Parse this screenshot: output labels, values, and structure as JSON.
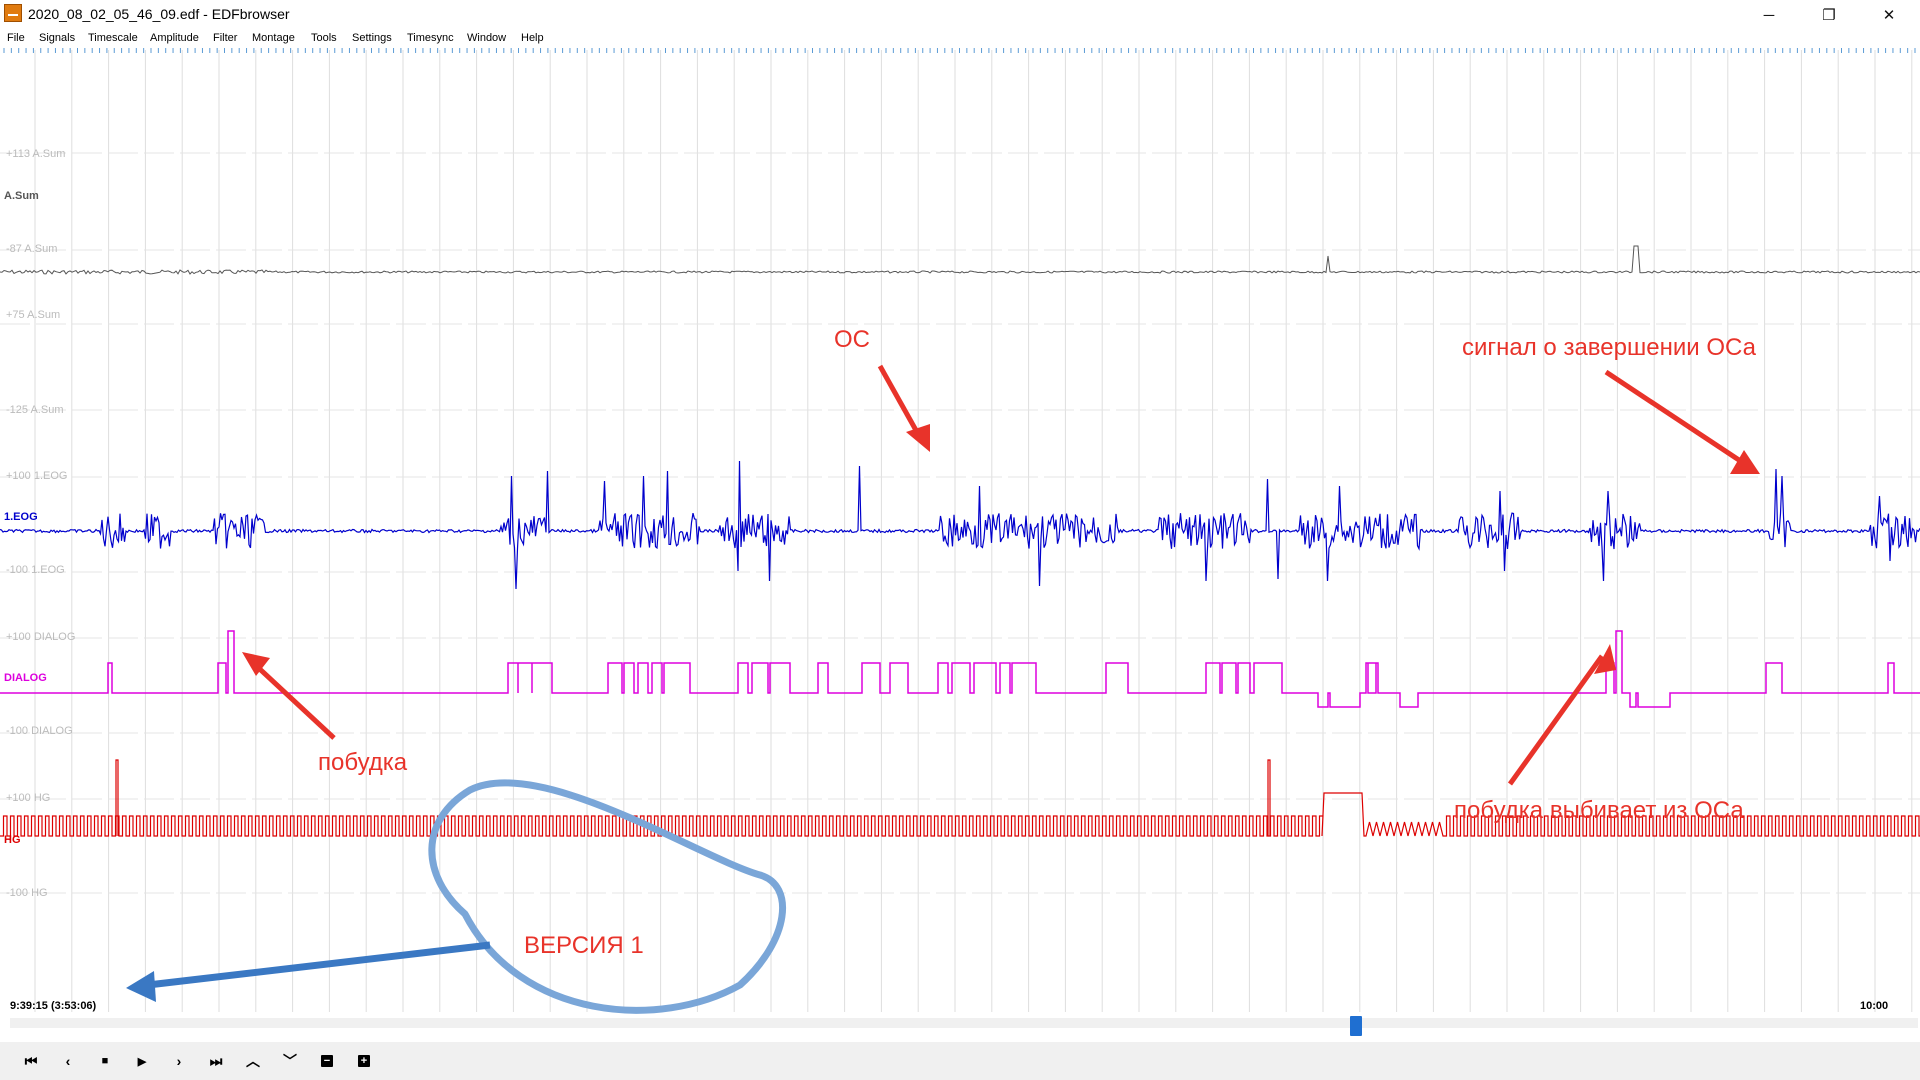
{
  "window": {
    "title": "2020_08_02_05_46_09.edf - EDFbrowser",
    "minimize_glyph": "─",
    "maximize_glyph": "❐",
    "close_glyph": "✕"
  },
  "menu": [
    "File",
    "Signals",
    "Timescale",
    "Amplitude",
    "Filter",
    "Montage",
    "Tools",
    "Settings",
    "Timesync",
    "Window",
    "Help"
  ],
  "signals": [
    {
      "name": "A.Sum",
      "top_label": "+113 A.Sum",
      "bottom_label": "-87 A.Sum",
      "color": "#555555"
    },
    {
      "name": "",
      "top_label": "+75 A.Sum",
      "bottom_label": "-125 A.Sum",
      "color": "#bbbbbb"
    },
    {
      "name": "1.EOG",
      "top_label": "+100 1.EOG",
      "bottom_label": "-100 1.EOG",
      "color": "#0000cc"
    },
    {
      "name": "DIALOG",
      "top_label": "+100 DIALOG",
      "bottom_label": "-100 DIALOG",
      "color": "#dd00dd"
    },
    {
      "name": "HG",
      "top_label": "+100 HG",
      "bottom_label": "-100 HG",
      "color": "#dd0000"
    }
  ],
  "time": {
    "start": "9:39:15 (3:53:06)",
    "end": "10:00"
  },
  "annotations": {
    "os": "ОС",
    "end_signal": "сигнал о завершении ОСа",
    "wake1": "побудка",
    "wake2": "побудка выбивает из ОСа",
    "version": "ВЕРСИЯ 1"
  },
  "annotation_colors": {
    "red": "#e8332a",
    "blue": "#3a78c3",
    "blue_circle": "#7aa6d8"
  },
  "scroll_position": 0.705,
  "toolbar": [
    {
      "name": "first-page-button",
      "glyph": "⏮"
    },
    {
      "name": "prev-button",
      "glyph": "‹"
    },
    {
      "name": "stop-button",
      "glyph": "■"
    },
    {
      "name": "play-button",
      "glyph": "▶"
    },
    {
      "name": "next-button",
      "glyph": "›"
    },
    {
      "name": "last-page-button",
      "glyph": "⏭"
    },
    {
      "name": "amplitude-up-button",
      "glyph": "︿"
    },
    {
      "name": "amplitude-down-button",
      "glyph": "﹀"
    },
    {
      "name": "zoom-out-button",
      "glyph": "−"
    },
    {
      "name": "zoom-in-button",
      "glyph": "+"
    }
  ]
}
